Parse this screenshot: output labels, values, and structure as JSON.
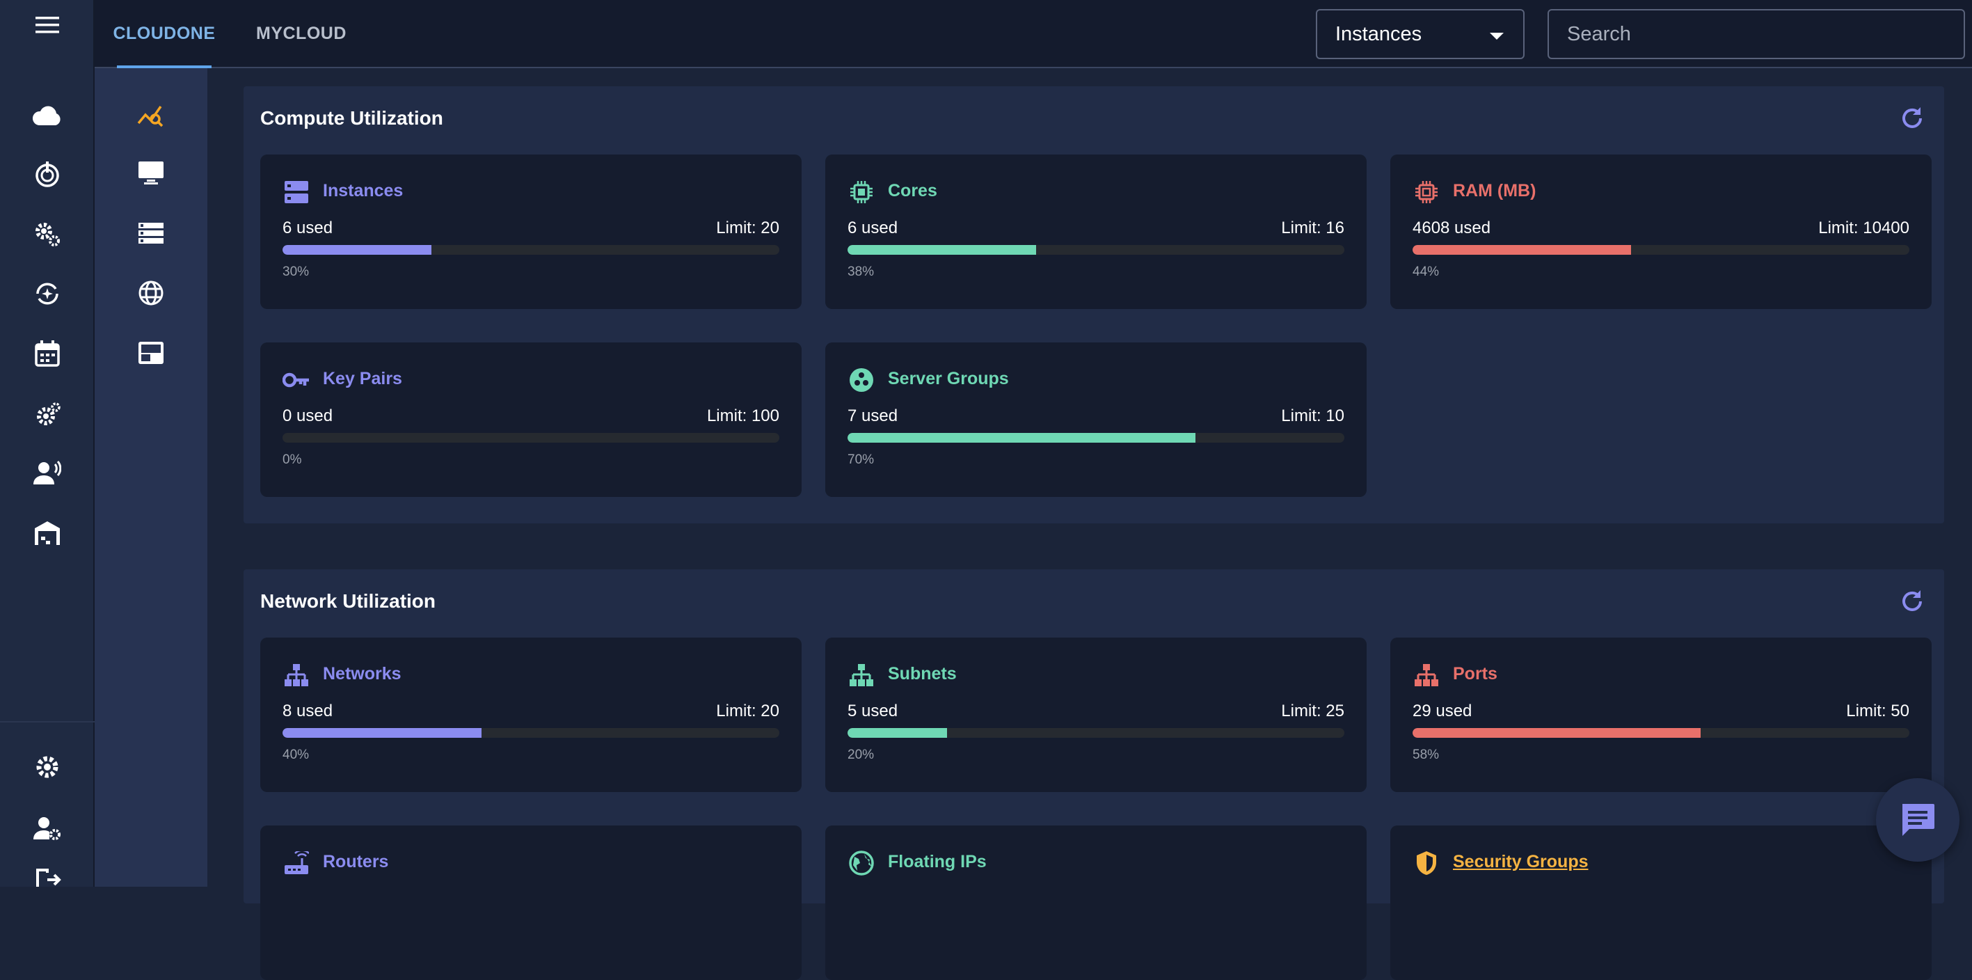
{
  "tabs": [
    {
      "label": "CLOUDONE",
      "active": true
    },
    {
      "label": "MYCLOUD",
      "active": false
    }
  ],
  "resource_select": {
    "value": "Instances"
  },
  "search": {
    "placeholder": "Search",
    "value": ""
  },
  "rail_icons": [
    "menu-icon",
    "cloud-icon",
    "monitoring-icon",
    "settings-cog-icon",
    "sync-icon",
    "calendar-icon",
    "advanced-settings-icon",
    "support-agent-icon",
    "warehouse-icon",
    "settings-icon",
    "user-settings-icon",
    "logout-icon"
  ],
  "subnav_icons": [
    "analytics-icon",
    "desktop-icon",
    "storage-icon",
    "globe-icon",
    "panel-icon"
  ],
  "colors": {
    "purple": "#8b8cf0",
    "teal": "#6fd8b4",
    "red": "#e8706a",
    "orange": "#f5b342"
  },
  "compute": {
    "title": "Compute Utilization",
    "cards": [
      {
        "title": "Instances",
        "used": "6 used",
        "limit": "Limit: 20",
        "pct": "30%",
        "fraction": 0.3,
        "color": "purple",
        "icon": "dns-icon"
      },
      {
        "title": "Cores",
        "used": "6 used",
        "limit": "Limit: 16",
        "pct": "38%",
        "fraction": 0.38,
        "color": "teal",
        "icon": "cpu-icon"
      },
      {
        "title": "RAM (MB)",
        "used": "4608 used",
        "limit": "Limit: 10400",
        "pct": "44%",
        "fraction": 0.44,
        "color": "red",
        "icon": "memory-icon"
      },
      {
        "title": "Key Pairs",
        "used": "0 used",
        "limit": "Limit: 100",
        "pct": "0%",
        "fraction": 0.0,
        "color": "purple",
        "icon": "key-icon"
      },
      {
        "title": "Server Groups",
        "used": "7 used",
        "limit": "Limit: 10",
        "pct": "70%",
        "fraction": 0.7,
        "color": "teal",
        "icon": "group-work-icon"
      }
    ]
  },
  "network": {
    "title": "Network Utilization",
    "cards": [
      {
        "title": "Networks",
        "used": "8 used",
        "limit": "Limit: 20",
        "pct": "40%",
        "fraction": 0.4,
        "color": "purple",
        "icon": "network-icon"
      },
      {
        "title": "Subnets",
        "used": "5 used",
        "limit": "Limit: 25",
        "pct": "20%",
        "fraction": 0.2,
        "color": "teal",
        "icon": "network-icon"
      },
      {
        "title": "Ports",
        "used": "29 used",
        "limit": "Limit: 50",
        "pct": "58%",
        "fraction": 0.58,
        "color": "red",
        "icon": "network-icon"
      },
      {
        "title": "Routers",
        "color": "purple",
        "icon": "router-icon"
      },
      {
        "title": "Floating IPs",
        "color": "teal",
        "icon": "public-icon"
      },
      {
        "title": "Security Groups",
        "color": "orange",
        "icon": "shield-icon"
      }
    ]
  }
}
